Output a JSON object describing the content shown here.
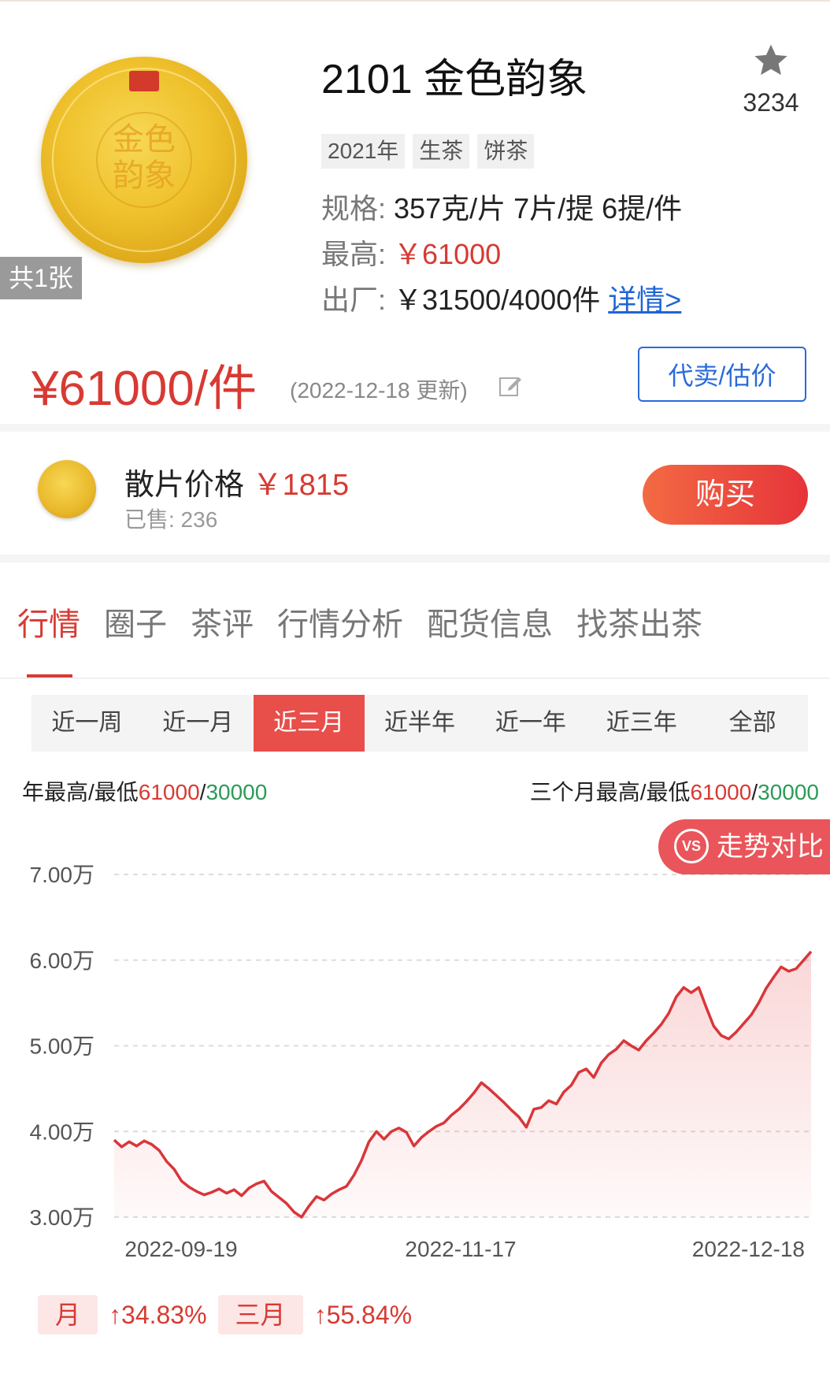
{
  "product": {
    "title": "2101 金色韵象",
    "favorite_count": "3234",
    "image_count": "共1张",
    "tags": [
      "2021年",
      "生茶",
      "饼茶"
    ],
    "spec_label": "规格:",
    "spec_value": "357克/片 7片/提 6提/件",
    "max_label": "最高:",
    "max_value": "￥61000",
    "factory_label": "出厂:",
    "factory_value": "￥31500/4000件",
    "detail_link": "详情>",
    "cake_text": "金色韵象"
  },
  "price": {
    "main": "¥61000/件",
    "updated": "(2022-12-18 更新)",
    "sell_button": "代卖/估价"
  },
  "loose": {
    "label": "散片价格",
    "price": "￥1815",
    "sold": "已售: 236",
    "buy_button": "购买"
  },
  "tabs": [
    "行情",
    "圈子",
    "茶评",
    "行情分析",
    "配货信息",
    "找茶出茶"
  ],
  "active_tab": "行情",
  "ranges": [
    "近一周",
    "近一月",
    "近三月",
    "近半年",
    "近一年",
    "近三年",
    "全部"
  ],
  "active_range": "近三月",
  "hilo": {
    "year_label": "年最高/最低",
    "year_high": "61000",
    "year_low": "30000",
    "three_month_label": "三个月最高/最低",
    "three_month_high": "61000",
    "three_month_low": "30000",
    "slash": "/"
  },
  "compare_button": "走势对比",
  "compare_icon": "VS",
  "chart_data": {
    "type": "area",
    "y_ticks": [
      "7.00万",
      "6.00万",
      "5.00万",
      "4.00万",
      "3.00万"
    ],
    "y_tick_values": [
      70000,
      60000,
      50000,
      40000,
      30000
    ],
    "ylim": [
      30000,
      70000
    ],
    "x_tick_labels": [
      "2022-09-19",
      "2022-11-17",
      "2022-12-18"
    ],
    "series": [
      {
        "values": [
          39000,
          38200,
          38800,
          38300,
          38900,
          38500,
          37800,
          36500,
          35600,
          34200,
          33500,
          33000,
          32600,
          32900,
          33300,
          32800,
          33200,
          32500,
          33400,
          33900,
          34200,
          33000,
          32300,
          31600,
          30600,
          30000,
          31300,
          32400,
          32000,
          32700,
          33200,
          33600,
          34900,
          36600,
          38800,
          40000,
          39100,
          40000,
          40400,
          39900,
          38300,
          39300,
          40000,
          40600,
          41000,
          41900,
          42600,
          43500,
          44500,
          45700,
          45000,
          44200,
          43400,
          42500,
          41700,
          40500,
          42600,
          42800,
          43600,
          43200,
          44600,
          45400,
          46900,
          47300,
          46300,
          48000,
          49000,
          49600,
          50600,
          50000,
          49500,
          50600,
          51500,
          52500,
          53800,
          55700,
          56800,
          56200,
          56800,
          54500,
          52300,
          51200,
          50800,
          51600,
          52600,
          53600,
          55000,
          56700,
          58000,
          59200,
          58700,
          59000,
          60000,
          61000
        ]
      }
    ],
    "grid": "horizontal dashed",
    "fill": "gradient"
  },
  "stats": {
    "month_label": "月",
    "month_value": "↑34.83%",
    "three_month_label": "三月",
    "three_month_value": "↑55.84%"
  },
  "colors": {
    "accent_red": "#d73a33",
    "low_green": "#2c9a57",
    "link_blue": "#1f64d6",
    "chart_line": "#d9363a"
  }
}
